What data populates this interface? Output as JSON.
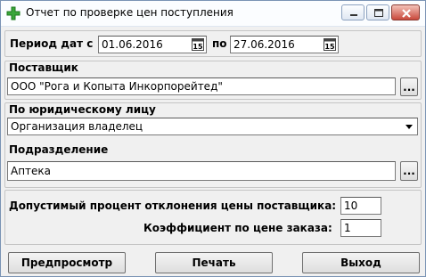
{
  "window": {
    "title": "Отчет по проверке цен поступления",
    "icon": "plus-cross-icon",
    "controls": [
      "minimize-icon",
      "maximize-icon",
      "close-icon"
    ]
  },
  "period": {
    "label": "Период дат с",
    "from": "01.06.2016",
    "to_label": "по",
    "to": "27.06.2016",
    "calendar_icon": "calendar-icon"
  },
  "supplier": {
    "label": "Поставщик",
    "value": "ООО \"Рога и Копыта Инкорпорейтед\"",
    "browse": "..."
  },
  "legal_entity": {
    "label": "По юридическому лицу",
    "value": "Организация владелец"
  },
  "division": {
    "label": "Подразделение",
    "value": "Аптека",
    "browse": "..."
  },
  "params": {
    "deviation_label": "Допустимый процент отклонения цены поставщика:",
    "deviation_value": "10",
    "coef_label": "Коэффициент по цене заказа:",
    "coef_value": "1"
  },
  "buttons": {
    "preview": "Предпросмотр",
    "print": "Печать",
    "exit": "Выход"
  },
  "colors": {
    "accent": "#3aa63a",
    "close": "#c9483b"
  }
}
